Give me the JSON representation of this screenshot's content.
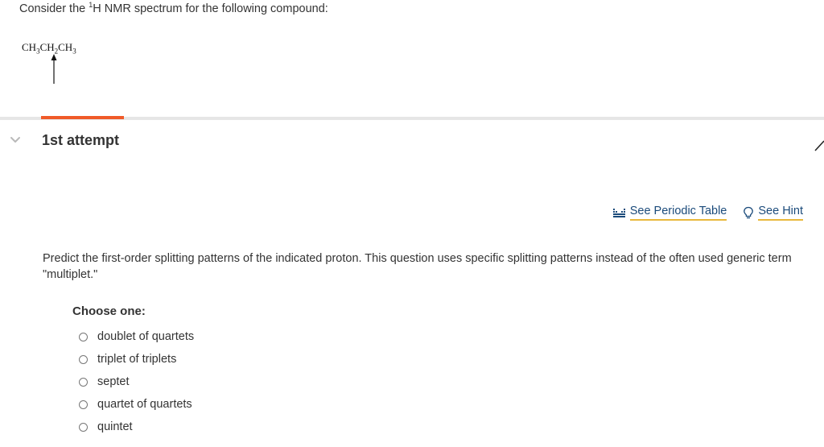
{
  "question": {
    "prefix": "Consider the ",
    "superscript": "1",
    "suffix": "H NMR spectrum for the following compound:"
  },
  "compound": {
    "parts": [
      "CH",
      "3",
      "CH",
      "2",
      "CH",
      "3"
    ]
  },
  "attempt": {
    "title": "1st attempt"
  },
  "tools": {
    "periodic_table": "See Periodic Table",
    "hint": "See Hint"
  },
  "prompt": "Predict the first-order splitting patterns of the indicated proton. This question uses specific splitting patterns instead of the often used generic term \"multiplet.\"",
  "choose_label": "Choose one:",
  "options": [
    "doublet of quartets",
    "triplet of triplets",
    "septet",
    "quartet of quartets",
    "quintet"
  ],
  "colors": {
    "accent": "#f05a28",
    "link_underline": "#e8b83c",
    "link_text": "#1a4a7a"
  },
  "icons": {
    "periodic_table": "periodic-table-icon",
    "hint": "lightbulb-icon",
    "toggle": "chevron-down-icon"
  }
}
